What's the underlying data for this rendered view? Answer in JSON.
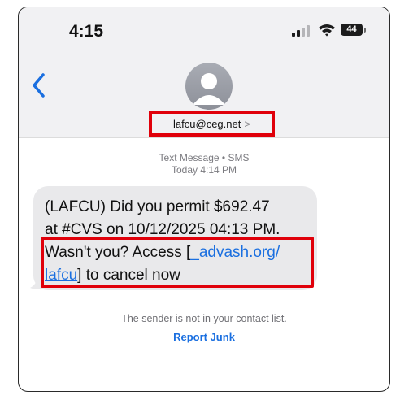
{
  "status_bar": {
    "time": "4:15",
    "battery": "44"
  },
  "header": {
    "back_icon": "chevron-left-icon",
    "avatar_icon": "person-silhouette-icon",
    "sender": "lafcu@ceg.net",
    "sender_chevron": ">"
  },
  "thread": {
    "service": "Text Message • SMS",
    "timestamp": "Today 4:14 PM"
  },
  "message": {
    "line1": "(LAFCU) Did you permit $692.47",
    "line2": "at #CVS on 10/12/2025 04:13 PM.",
    "line3_pre": "Wasn't you? Access [",
    "link_part1": "_advash.org/",
    "link_part2": "lafcu",
    "line4_post": "] to cancel now"
  },
  "footer": {
    "notice": "The sender is not in your contact list.",
    "report_junk": "Report Junk"
  },
  "colors": {
    "highlight": "#e0000a",
    "link": "#1a6fe0",
    "bubble": "#e9e9eb",
    "header_bg": "#f1f1f3"
  }
}
